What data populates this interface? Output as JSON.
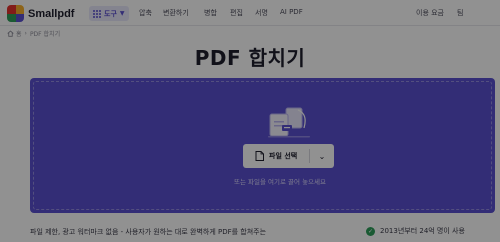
{
  "header": {
    "logo_text": "Smallpdf",
    "tools_label": "도구",
    "nav": [
      "압축",
      "변환하기",
      "병합",
      "편집",
      "서명",
      "AI PDF"
    ],
    "pricing_label": "이용 요금",
    "team_label": "팀"
  },
  "breadcrumb": {
    "home": "홈",
    "separator": "›",
    "current": "PDF 합치기"
  },
  "page_title": "PDF 합치기",
  "dropzone": {
    "choose_button_label": "파일 선택",
    "hint": "또는 파일을 여기로 끌어 놓으세요"
  },
  "description": {
    "line1": "파일 제한, 광고 워터마크 없음 - 사용자가 원하는 대로 완벽하게 PDF를 합쳐주는",
    "line2": ""
  },
  "trust_badge": "2013년부터 24억 명이 사용",
  "icons": {
    "logo": "smallpdf-logo-icon",
    "tools": "grid-icon",
    "home": "home-icon",
    "files": "files-illustration-icon",
    "file": "file-icon",
    "dropdown": "chevron-down-icon",
    "check": "check-circle-icon"
  },
  "colors": {
    "brand": "#5a4fcf",
    "dropzone": "#5a4fcf",
    "success": "#2e9e5b"
  }
}
